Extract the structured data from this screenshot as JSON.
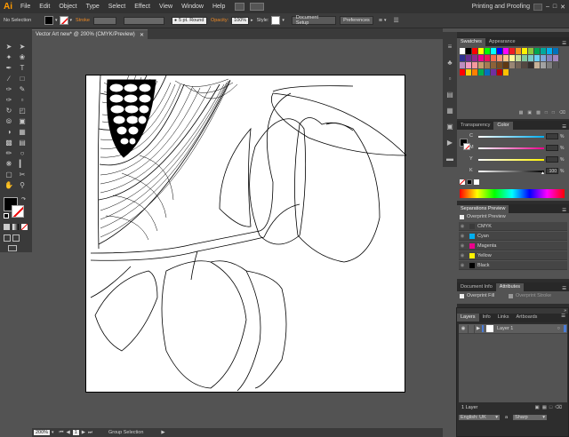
{
  "menu": {
    "logo": "Ai",
    "items": [
      "File",
      "Edit",
      "Object",
      "Type",
      "Select",
      "Effect",
      "View",
      "Window",
      "Help"
    ],
    "workspace": "Printing and Proofing"
  },
  "control": {
    "selection": "No Selection",
    "stroke_label": "Stroke",
    "brush": "5 pt. Round",
    "opacity_label": "Opacity:",
    "opacity_value": "100%",
    "style_label": "Style:",
    "doc_setup": "Document Setup",
    "preferences": "Preferences"
  },
  "document": {
    "tab_title": "Vector Art new* @ 200% (CMYK/Preview)"
  },
  "status": {
    "zoom": "200%",
    "page": "1",
    "tool": "Group Selection"
  },
  "swatches": {
    "tabs": [
      "Swatches",
      "Appearance"
    ]
  },
  "color": {
    "tabs": [
      "Transparency",
      "Color"
    ],
    "sliders": [
      {
        "label": "C",
        "value": ""
      },
      {
        "label": "M",
        "value": ""
      },
      {
        "label": "Y",
        "value": ""
      },
      {
        "label": "K",
        "value": "100"
      }
    ],
    "unit": "%"
  },
  "separations": {
    "title": "Separations Preview",
    "overprint": "Overprint Preview",
    "plates": [
      {
        "name": "CMYK",
        "color": "#3a3a3a"
      },
      {
        "name": "Cyan",
        "color": "#00aeef"
      },
      {
        "name": "Magenta",
        "color": "#ec008c"
      },
      {
        "name": "Yellow",
        "color": "#fff200"
      },
      {
        "name": "Black",
        "color": "#000000"
      }
    ]
  },
  "attributes": {
    "tabs": [
      "Document Info",
      "Attributes"
    ],
    "overprint_fill": "Overprint Fill",
    "overprint_stroke": "Overprint Stroke"
  },
  "layers": {
    "tabs": [
      "Layers",
      "Info",
      "Links",
      "Artboards"
    ],
    "items": [
      {
        "name": "Layer 1"
      }
    ],
    "count": "1 Layer",
    "language": "English: UK",
    "antialias": "Sharp"
  }
}
